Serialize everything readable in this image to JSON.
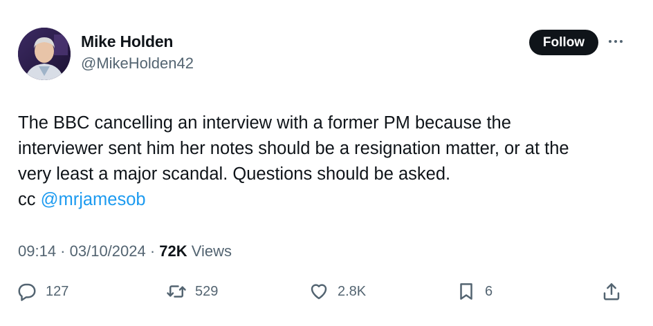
{
  "author": {
    "name": "Mike Holden",
    "handle": "@MikeHolden42"
  },
  "follow_label": "Follow",
  "more_icon": "more-horizontal-icon",
  "tweet": {
    "line1": "The BBC cancelling an interview with a former PM because the",
    "line2": "interviewer sent him her notes should be a resignation matter, or at the",
    "line3": "very least a major scandal. Questions should be asked.",
    "cc_prefix": "cc ",
    "mention": "@mrjamesob"
  },
  "meta": {
    "time": "09:14",
    "separator": " · ",
    "date": "03/10/2024",
    "views_count": "72K",
    "views_label": " Views"
  },
  "actions": {
    "replies": "127",
    "reposts": "529",
    "likes": "2.8K",
    "bookmarks": "6"
  },
  "colors": {
    "text": "#0f1419",
    "secondary": "#536471",
    "link": "#1d9bf0",
    "button_bg": "#0f1419"
  }
}
